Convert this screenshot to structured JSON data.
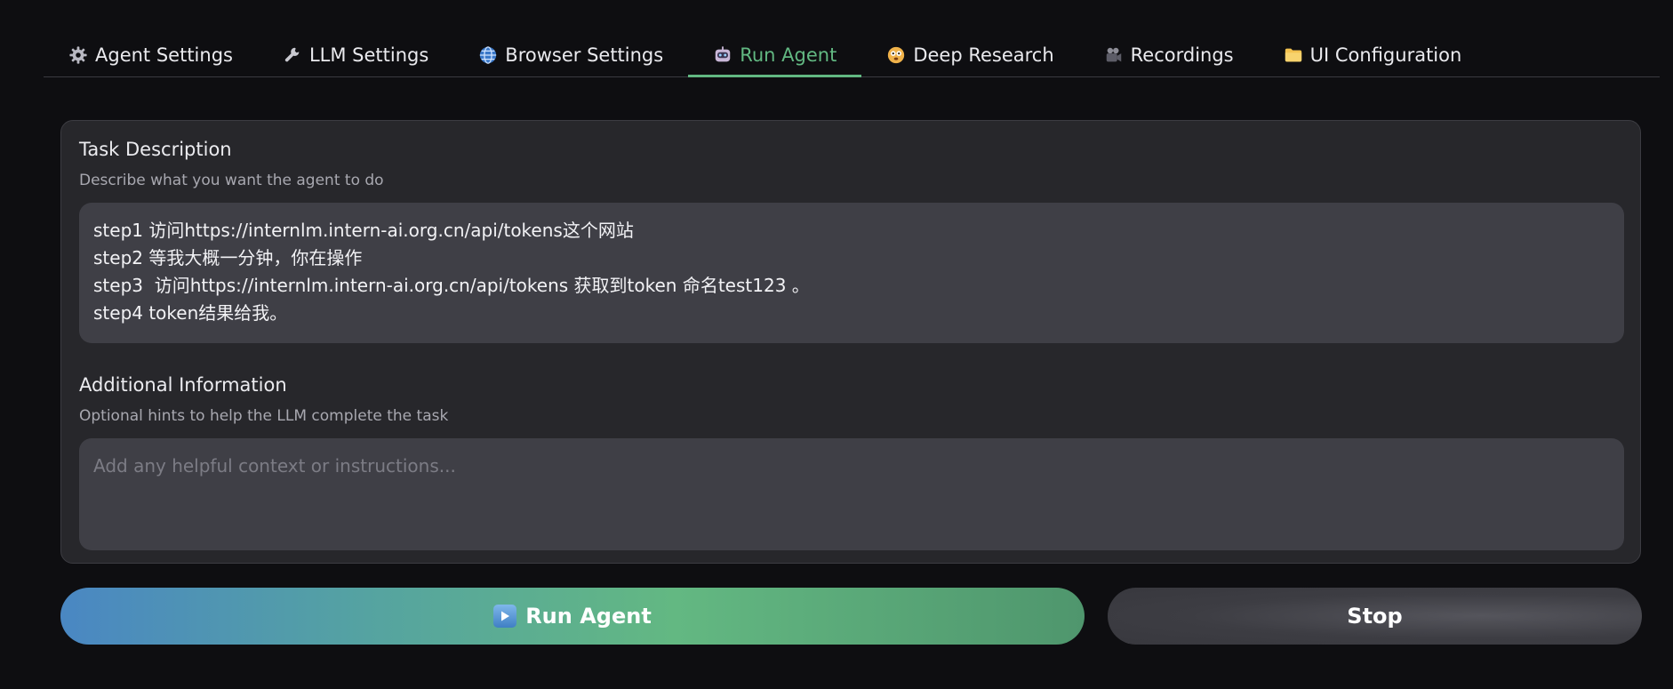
{
  "tabs": [
    {
      "label": "Agent Settings",
      "icon": "gear-icon"
    },
    {
      "label": "LLM Settings",
      "icon": "wrench-icon"
    },
    {
      "label": "Browser Settings",
      "icon": "globe-icon"
    },
    {
      "label": "Run Agent",
      "icon": "robot-icon",
      "active": true
    },
    {
      "label": "Deep Research",
      "icon": "face-icon"
    },
    {
      "label": "Recordings",
      "icon": "camera-icon"
    },
    {
      "label": "UI Configuration",
      "icon": "folder-icon"
    }
  ],
  "task": {
    "title": "Task Description",
    "hint": "Describe what you want the agent to do",
    "lines": [
      "step1 访问https://internlm.intern-ai.org.cn/api/tokens这个网站",
      "step2 等我大概一分钟，你在操作",
      "step3  访问https://internlm.intern-ai.org.cn/api/tokens 获取到token 命名test123 。",
      "step4 token结果给我。"
    ]
  },
  "additional": {
    "title": "Additional Information",
    "hint": "Optional hints to help the LLM complete the task",
    "placeholder": "Add any helpful context or instructions..."
  },
  "buttons": {
    "run_label": "Run Agent",
    "stop_label": "Stop"
  },
  "colors": {
    "accent": "#62b882",
    "background": "#0e0e11",
    "panel": "#27272b",
    "input": "#3f3f46"
  }
}
